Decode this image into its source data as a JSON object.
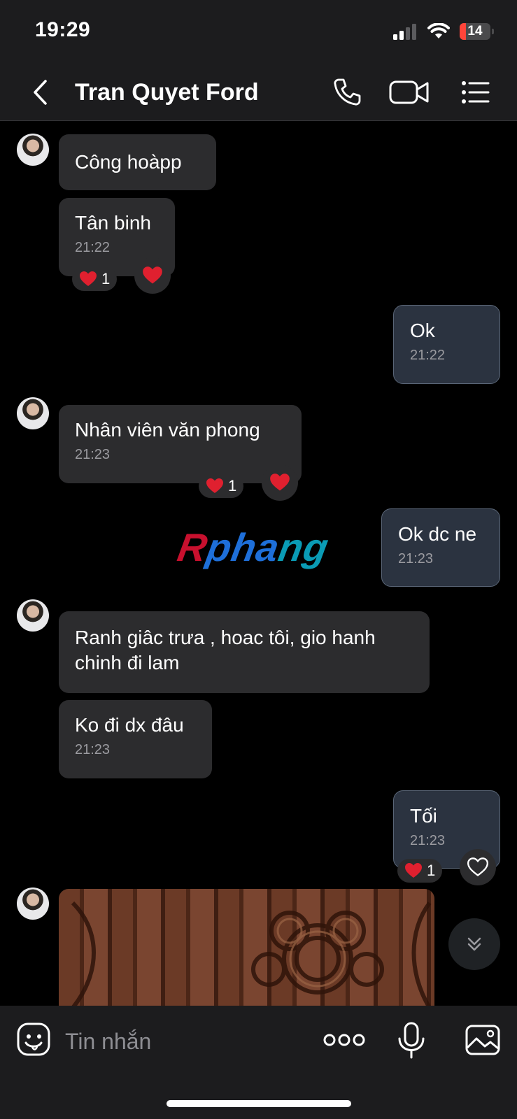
{
  "status_bar": {
    "time": "19:29",
    "battery_level": "14",
    "battery_fraction": 0.14,
    "icons": [
      "signal-icon",
      "wifi-icon",
      "battery-icon"
    ]
  },
  "header": {
    "title": "Tran Quyet Ford",
    "icons": [
      "back-chevron-icon",
      "phone-icon",
      "video-camera-icon",
      "menu-list-icon"
    ]
  },
  "messages": [
    {
      "sender": "them",
      "text": "Công hoàpp"
    },
    {
      "sender": "them",
      "text": "Tân binh",
      "time": "21:22",
      "reaction": {
        "emoji": "❤️",
        "count": "1"
      }
    },
    {
      "sender": "me",
      "text": "Ok",
      "time": "21:22"
    },
    {
      "sender": "them",
      "text": "Nhân viên văn phong",
      "time": "21:23",
      "reaction": {
        "emoji": "❤️",
        "count": "1"
      }
    },
    {
      "sender": "me",
      "text": "Ok dc ne",
      "time": "21:23"
    },
    {
      "sender": "them",
      "text": "Ranh giâc trưa , hoac tôi, gio hanh chinh đi lam"
    },
    {
      "sender": "them",
      "text": "Ko đi dx đâu",
      "time": "21:23"
    },
    {
      "sender": "me",
      "text": "Tối",
      "time": "21:23",
      "reaction": {
        "emoji": "❤️",
        "count": "1"
      }
    },
    {
      "sender": "them",
      "type": "image",
      "description": "carved wooden door photo"
    }
  ],
  "watermark": {
    "text": "Rphang",
    "colors": [
      "#c8102e",
      "#1e6fd9",
      "#0a9bb5"
    ]
  },
  "composer": {
    "placeholder": "Tin nhắn",
    "icons": [
      "sticker-icon",
      "more-dots-icon",
      "microphone-icon",
      "image-icon"
    ]
  },
  "colors": {
    "background": "#000000",
    "bar_background": "#1c1c1e",
    "bubble_them": "#2c2c2e",
    "bubble_me": "#2b3340",
    "bubble_me_border": "#5a6677",
    "time_text": "#9b9ba0",
    "heart": "#e0202f"
  }
}
